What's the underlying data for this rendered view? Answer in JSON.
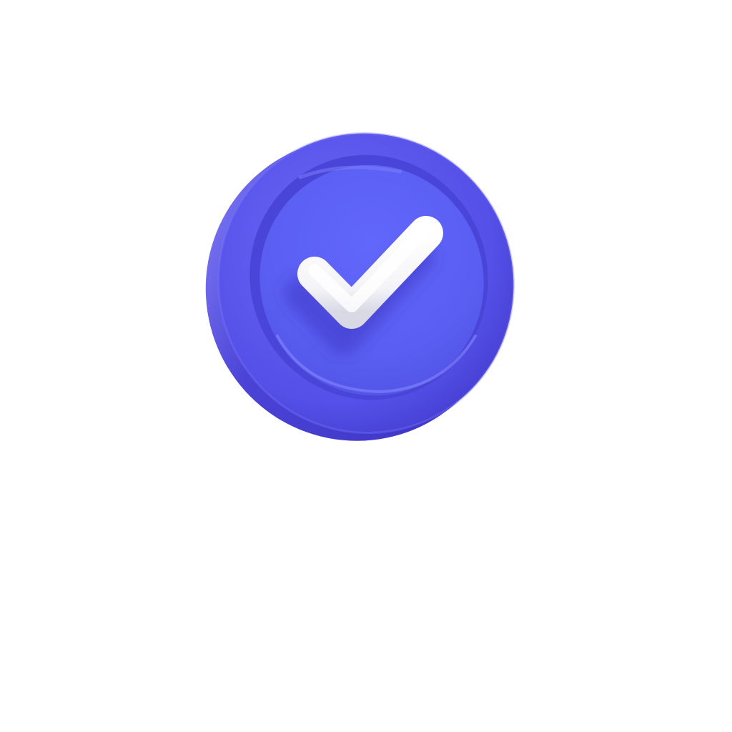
{
  "icon": {
    "name": "check-badge-icon",
    "colors": {
      "coin_edge": "#4a44d8",
      "coin_rim": "#5c58ee",
      "coin_face": "#5c5ff2",
      "coin_highlight": "#8a8cff",
      "check": "#ffffff",
      "background": "#ffffff"
    }
  }
}
